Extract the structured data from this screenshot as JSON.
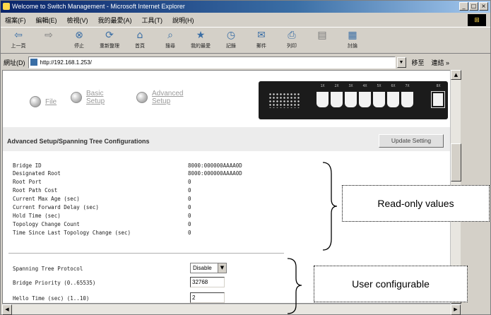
{
  "window": {
    "title": "Welcome to Switch Management - Microsoft Internet Explorer",
    "buttons": [
      "_",
      "□",
      "×"
    ],
    "windows_logo": "⊞"
  },
  "menu": [
    "檔案(F)",
    "編輯(E)",
    "檢視(V)",
    "我的最愛(A)",
    "工具(T)",
    "說明(H)"
  ],
  "toolbar": [
    {
      "label": "上一頁",
      "icon": "back-arrow-icon",
      "glyph": "⇦"
    },
    {
      "label": "",
      "icon": "forward-arrow-icon",
      "glyph": "⇨"
    },
    {
      "label": "停止",
      "icon": "stop-icon",
      "glyph": "⊗"
    },
    {
      "label": "重新整理",
      "icon": "refresh-icon",
      "glyph": "⟳"
    },
    {
      "label": "首頁",
      "icon": "home-icon",
      "glyph": "⌂"
    },
    {
      "label": "搜尋",
      "icon": "search-icon",
      "glyph": "⌕"
    },
    {
      "label": "我的最愛",
      "icon": "favorites-icon",
      "glyph": "★"
    },
    {
      "label": "記錄",
      "icon": "history-icon",
      "glyph": "◷"
    },
    {
      "label": "郵件",
      "icon": "mail-icon",
      "glyph": "✉"
    },
    {
      "label": "列印",
      "icon": "print-icon",
      "glyph": "⎙"
    },
    {
      "label": "",
      "icon": "edit-icon",
      "glyph": "▤"
    },
    {
      "label": "討論",
      "icon": "discuss-icon",
      "glyph": "▦"
    }
  ],
  "address": {
    "label": "網址(D)",
    "url": "http://192.168.1.253/",
    "go": "移至",
    "links": "連結 »"
  },
  "nav": [
    {
      "label": "File"
    },
    {
      "label": "Basic\nSetup"
    },
    {
      "label": "Advanced\nSetup"
    }
  ],
  "device": {
    "port_numbers": [
      "1X",
      "2X",
      "3X",
      "4X",
      "5X",
      "6X",
      "7X",
      "8X"
    ]
  },
  "section": {
    "title": "Advanced Setup/Spanning Tree Configurations",
    "update_button": "Update Setting"
  },
  "readonly": [
    {
      "label": "Bridge ID",
      "value": "8000:000000AAAA0D"
    },
    {
      "label": "Designated Root",
      "value": "8000:000000AAAA0D"
    },
    {
      "label": "Root Port",
      "value": "0"
    },
    {
      "label": "Root Path Cost",
      "value": "0"
    },
    {
      "label": "Current Max Age (sec)",
      "value": "0"
    },
    {
      "label": "Current Forward Delay (sec)",
      "value": "0"
    },
    {
      "label": "Hold Time (sec)",
      "value": "0"
    },
    {
      "label": "Topology Change Count",
      "value": "0"
    },
    {
      "label": "Time Since Last Topology Change (sec)",
      "value": "0"
    }
  ],
  "config": {
    "protocol": {
      "label": "Spanning Tree Protocol",
      "value": "Disable"
    },
    "priority": {
      "label": "Bridge Priority (0..65535)",
      "value": "32768"
    },
    "hello": {
      "label": "Hello Time (sec) (1..10)",
      "value": "2"
    }
  },
  "annotations": {
    "readonly_label": "Read-only values",
    "configurable_label": "User configurable"
  }
}
